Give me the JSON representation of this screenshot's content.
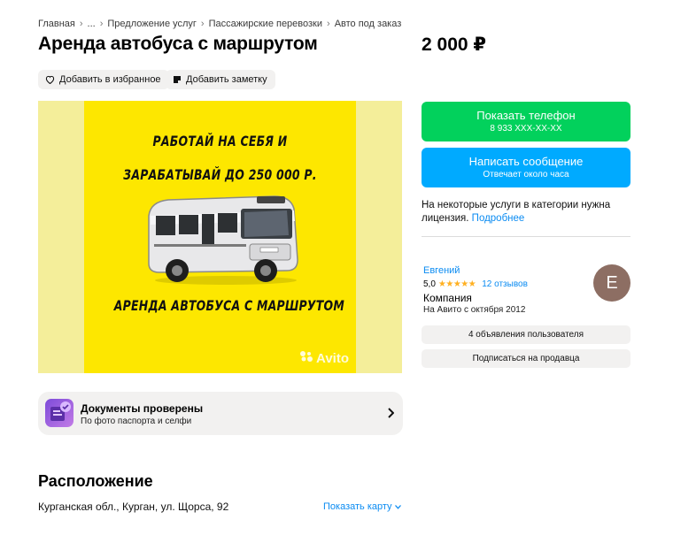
{
  "breadcrumb": {
    "items": [
      "Главная",
      "...",
      "Предложение услуг",
      "Пассажирские перевозки",
      "Авто под заказ"
    ]
  },
  "listing": {
    "title": "Аренда автобуса с маршрутом",
    "price": "2 000 ₽",
    "favorite_label": "Добавить в избранное",
    "note_label": "Добавить заметку"
  },
  "photo": {
    "poster_line1": "РАБОТАЙ НА СЕБЯ И",
    "poster_line2": "ЗАРАБАТЫВАЙ ДО 250 000 Р.",
    "poster_line3": "АРЕНДА АВТОБУСА С МАРШРУТОМ",
    "watermark": "Avito",
    "colors": {
      "poster": "#fde700",
      "background": "#f4ee9a"
    }
  },
  "documents": {
    "title": "Документы проверены",
    "subtitle": "По фото паспорта и селфи"
  },
  "location": {
    "heading": "Расположение",
    "address": "Курганская обл., Курган, ул. Щорса, 92",
    "map_link": "Показать карту"
  },
  "contact": {
    "phone_label": "Показать телефон",
    "phone_masked": "8 933 XXX-XX-XX",
    "message_label": "Написать сообщение",
    "message_sub": "Отвечает около часа",
    "license_text": "На некоторые услуги в категории нужна лицензия.",
    "license_link": "Подробнее",
    "colors": {
      "phone": "#02d15c",
      "message": "#00aaff",
      "link": "#0a8bf2"
    }
  },
  "seller": {
    "name": "Евгений",
    "rating": "5,0",
    "stars": "★★★★★",
    "reviews": "12 отзывов",
    "type": "Компания",
    "since": "На Авито с октября 2012",
    "avatar_letter": "E",
    "listings_button": "4 объявления пользователя",
    "subscribe_button": "Подписаться на продавца"
  },
  "icons": [
    "heart-icon",
    "note-icon",
    "documents-check-icon",
    "chevron-right-icon",
    "chevron-down-icon",
    "avito-logo-icon"
  ]
}
